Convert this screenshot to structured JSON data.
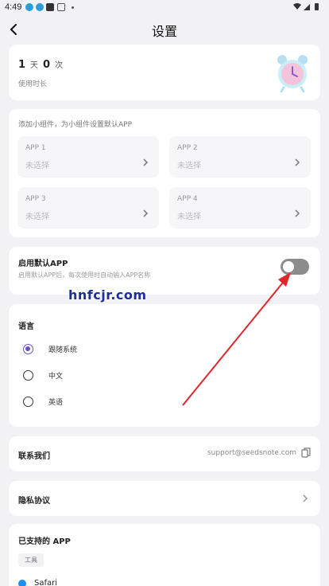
{
  "status_bar": {
    "time": "4:49"
  },
  "header": {
    "title": "设置"
  },
  "usage": {
    "days_value": "1",
    "days_unit": "天",
    "times_value": "0",
    "times_unit": "次",
    "label": "使用时长"
  },
  "widget": {
    "hint": "添加小组件，为小组件设置默认APP",
    "slots": [
      {
        "name": "APP 1",
        "value": "未选择"
      },
      {
        "name": "APP 2",
        "value": "未选择"
      },
      {
        "name": "APP 3",
        "value": "未选择"
      },
      {
        "name": "APP 4",
        "value": "未选择"
      }
    ]
  },
  "default_app": {
    "title": "启用默认APP",
    "subtitle": "启用默认APP后，每次使用时自动输入APP名称",
    "enabled": false
  },
  "language": {
    "title": "语言",
    "options": [
      {
        "label": "跟随系统",
        "selected": true
      },
      {
        "label": "中文",
        "selected": false
      },
      {
        "label": "英语",
        "selected": false
      }
    ]
  },
  "contact": {
    "label": "联系我们",
    "email": "support@seedsnote.com"
  },
  "privacy": {
    "label": "隐私协议"
  },
  "supported_apps": {
    "title": "已支持的 APP",
    "tag": "工具",
    "items": [
      {
        "name": "Safari"
      }
    ]
  },
  "watermark": "hnfcjr.com",
  "colors": {
    "accent": "#6a4fc4",
    "arrow": "#e0262b",
    "toggle_off": "#8c8c8c"
  }
}
